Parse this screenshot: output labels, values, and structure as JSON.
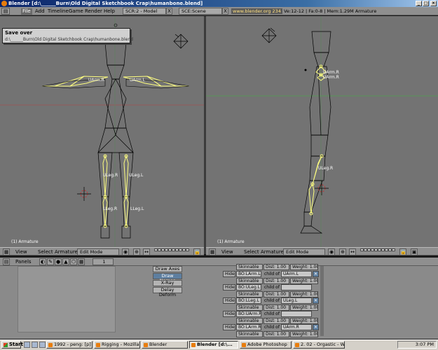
{
  "window": {
    "title": "Blender [d:\\______Burn\\Old Digital Sketchbook Crap\\humanbone.blend]",
    "controls": [
      "_",
      "□",
      "×"
    ]
  },
  "menubar": {
    "menus": [
      "File",
      "Add",
      "Timeline",
      "Game",
      "Render",
      "Help"
    ],
    "screen_field": "SCR:2 - Model",
    "scene_field": "SCE:Scene",
    "close_glyph": "X",
    "url": "www.blender.org 234",
    "stats": "Ve:12-12 | Fa:0-8 | Mem:1.29M Armature"
  },
  "save_popup": {
    "title": "Save over",
    "path": "d:\\______Burn\\Old Digital Sketchbook Crap\\humanbone.blend"
  },
  "viewports": {
    "left": {
      "label": "(1) Armature",
      "bone_labels": [
        "UArm.R",
        "UArm.L",
        "ULeg.R",
        "ULeg.L",
        "LLeg.R",
        "LLeg.L"
      ]
    },
    "right": {
      "label": "(1) Armature",
      "bone_labels": [
        "UArm.R",
        "UArm.R",
        "ULeg.R"
      ]
    }
  },
  "view_header": {
    "items": [
      "View",
      "Select",
      "Armature"
    ],
    "mode": "Edit Mode"
  },
  "buttons_window": {
    "panels_label": "Panels",
    "page_value": "1",
    "options": [
      {
        "label": "Draw Axes",
        "on": false
      },
      {
        "label": "Draw Names",
        "on": true
      },
      {
        "label": "X-Ray",
        "on": false
      },
      {
        "label": "Delay Deform",
        "on": false
      }
    ],
    "bones": [
      {
        "name": "BO:LArm.L",
        "parent": "UArm.L",
        "child_of": "child of",
        "skinnable": "Skinnable",
        "dist": "Dist: 1.00",
        "weight": "Weight: 1.00"
      },
      {
        "name": "BO:ULeg.L",
        "parent": "",
        "child_of": "child of",
        "skinnable": "Skinnable",
        "dist": "Dist: 1.00",
        "weight": "Weight: 1.00"
      },
      {
        "name": "BO:LLeg.L",
        "parent": "ULeg.L",
        "child_of": "child of",
        "skinnable": "Skinnable",
        "dist": "Dist: 1.00",
        "weight": "Weight: 1.00"
      },
      {
        "name": "BO:UArm.R",
        "parent": "",
        "child_of": "child of",
        "skinnable": "Skinnable",
        "dist": "Dist: 1.00",
        "weight": "Weight: 1.00"
      },
      {
        "name": "BO:LArm.R",
        "parent": "UArm.R",
        "child_of": "child of",
        "skinnable": "Skinnable",
        "dist": "Dist: 1.00",
        "weight": "Weight: 1.00"
      }
    ],
    "partial_row": {
      "skinnable": "Skinnable",
      "dist": "Dist: 1.00",
      "weight": "Weight: 1.00"
    },
    "hide_label": "Hide"
  },
  "taskbar": {
    "start": "Start",
    "tasks": [
      "1992 - peng: [p]",
      "Rigging - Mozilla",
      "Blender",
      "Blender [d:\\...",
      "Adobe Photoshop",
      "2. 02 - Orgastic - Win..."
    ],
    "active_task_index": 3,
    "clock": "3:07 PM"
  },
  "colors": {
    "viewport_bg": "#737373",
    "bone_selected": "#ffff80",
    "bone_wire": "#000000",
    "header_bg": "#8f8f8f",
    "x_axis_line": "#a05050",
    "y_axis_line": "#50a050"
  }
}
